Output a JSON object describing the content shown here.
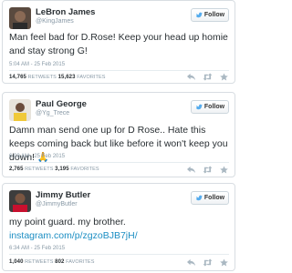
{
  "tweets": [
    {
      "name": "LeBron James",
      "handle": "@KingJames",
      "text": "Man feel bad for D.Rose! Keep your head up homie and stay strong G!",
      "timestamp": "5:04 AM - 25 Feb 2015",
      "retweets": "14,765",
      "retweets_label": "RETWEETS",
      "favorites": "15,623",
      "favorites_label": "FAVORITES",
      "follow_label": "Follow"
    },
    {
      "name": "Paul George",
      "handle": "@Yg_Trece",
      "text": "Damn man send one up for D Rose.. Hate this keeps coming back but like before it won't keep you down! 🙏",
      "timestamp": "6:03 AM - 25 Feb 2015",
      "retweets": "2,765",
      "retweets_label": "RETWEETS",
      "favorites": "3,195",
      "favorites_label": "FAVORITES",
      "follow_label": "Follow"
    },
    {
      "name": "Jimmy Butler",
      "handle": "@JimmyButler",
      "text": "my point guard. my brother.",
      "link": "instagram.com/p/zgzoBJB7jH/",
      "timestamp": "6:34 AM - 25 Feb 2015",
      "retweets": "1,040",
      "retweets_label": "RETWEETS",
      "favorites": "802",
      "favorites_label": "FAVORITES",
      "follow_label": "Follow"
    }
  ],
  "colors": {
    "link": "#1c8ec3",
    "meta": "#8899a6",
    "text": "#292f33"
  },
  "icons": [
    "verified-badge",
    "follow-bird-icon",
    "reply-icon",
    "retweet-icon",
    "favorite-icon"
  ]
}
